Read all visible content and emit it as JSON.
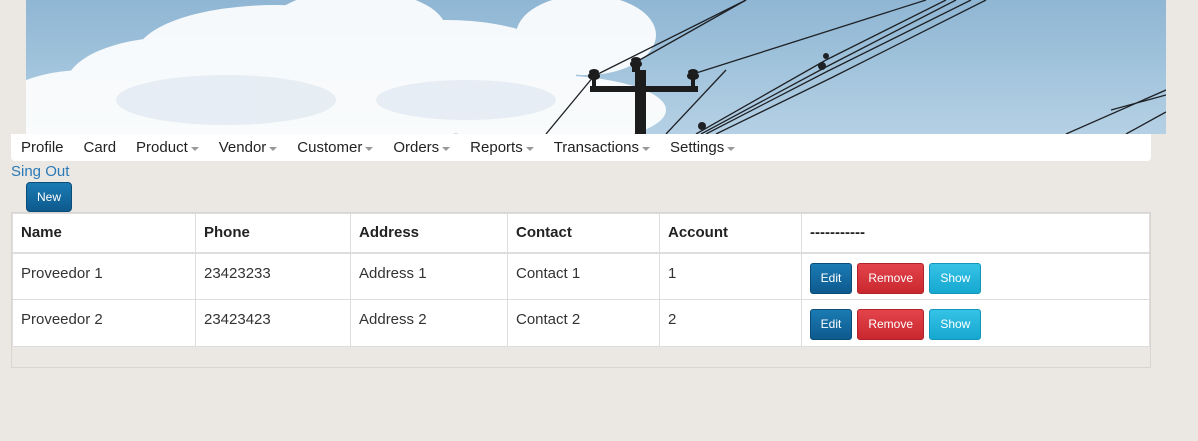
{
  "nav": {
    "items": [
      {
        "label": "Profile",
        "dropdown": false
      },
      {
        "label": "Card",
        "dropdown": false
      },
      {
        "label": "Product",
        "dropdown": true
      },
      {
        "label": "Vendor",
        "dropdown": true
      },
      {
        "label": "Customer",
        "dropdown": true
      },
      {
        "label": "Orders",
        "dropdown": true
      },
      {
        "label": "Reports",
        "dropdown": true
      },
      {
        "label": "Transactions",
        "dropdown": true
      },
      {
        "label": "Settings",
        "dropdown": true
      }
    ],
    "signout_label": "Sing Out"
  },
  "toolbar": {
    "new_label": "New"
  },
  "table": {
    "headers": [
      "Name",
      "Phone",
      "Address",
      "Contact",
      "Account",
      "-----------"
    ],
    "rows": [
      {
        "name": "Proveedor 1",
        "phone": "23423233",
        "address": "Address 1",
        "contact": "Contact 1",
        "account": "1"
      },
      {
        "name": "Proveedor 2",
        "phone": "23423423",
        "address": "Address 2",
        "contact": "Contact 2",
        "account": "2"
      }
    ],
    "actions": {
      "edit_label": "Edit",
      "remove_label": "Remove",
      "show_label": "Show"
    }
  },
  "colors": {
    "page_bg": "#ebe8e4",
    "link": "#2a7ab8",
    "primary": "#0d5a8e",
    "danger": "#c9282f",
    "info": "#16a8d0"
  }
}
